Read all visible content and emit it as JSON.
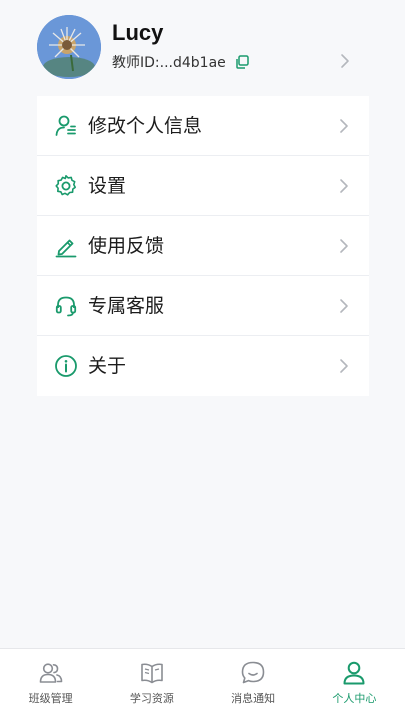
{
  "profile": {
    "name": "Lucy",
    "id_text": "教师ID:...d4b1ae"
  },
  "menu": {
    "items": [
      {
        "label": "修改个人信息",
        "icon": "user-edit-icon"
      },
      {
        "label": "设置",
        "icon": "gear-icon"
      },
      {
        "label": "使用反馈",
        "icon": "pencil-icon"
      },
      {
        "label": "专属客服",
        "icon": "headset-icon"
      },
      {
        "label": "关于",
        "icon": "info-icon"
      }
    ]
  },
  "tabbar": {
    "tabs": [
      {
        "label": "班级管理",
        "icon": "users-icon",
        "active": false
      },
      {
        "label": "学习资源",
        "icon": "book-icon",
        "active": false
      },
      {
        "label": "消息通知",
        "icon": "chat-bubble-icon",
        "active": false
      },
      {
        "label": "个人中心",
        "icon": "person-icon",
        "active": true
      }
    ]
  },
  "colors": {
    "accent": "#1a9a6c",
    "background": "#f7f8fa",
    "card": "#ffffff",
    "chevron": "#b4b7bd",
    "tab_inactive": "#8a8d93"
  }
}
